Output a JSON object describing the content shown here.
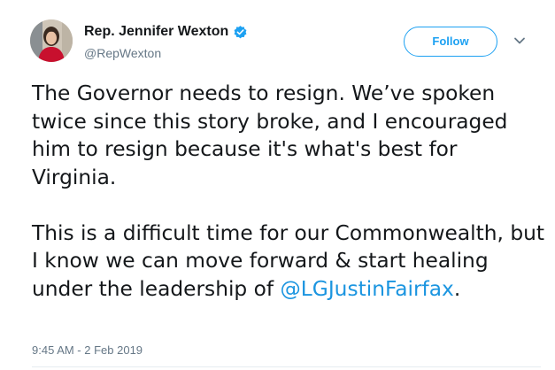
{
  "author": {
    "display_name": "Rep. Jennifer Wexton",
    "handle": "@RepWexton",
    "verified_icon": "verified-badge-icon",
    "avatar_icon": "profile-photo"
  },
  "actions": {
    "follow_label": "Follow",
    "menu_icon": "chevron-down-icon"
  },
  "tweet": {
    "paragraph_1": "The Governor needs to resign. We’ve spoken twice since this story broke, and I encouraged him to resign because it's what's best for Virginia.",
    "paragraph_2_text": "This is a difficult time for our Commonwealth, but I know we can move forward & start healing under the leadership of ",
    "mention": "@LGJustinFairfax",
    "paragraph_2_end": ".",
    "timestamp": "9:45 AM - 2 Feb 2019"
  },
  "colors": {
    "accent": "#1da1f2",
    "link": "#1b95e0",
    "text": "#14171a",
    "muted": "#657786"
  }
}
